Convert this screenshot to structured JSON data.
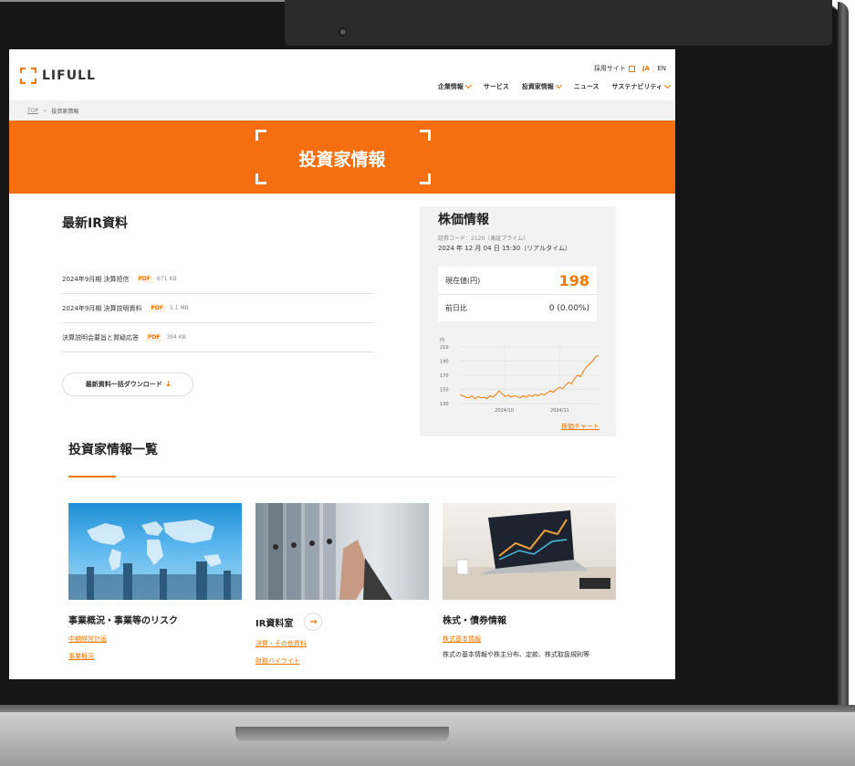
{
  "header": {
    "logo": "LIFULL",
    "top_links": {
      "recruit": "採用サイト",
      "lang_ja": "JA",
      "lang_en": "EN"
    },
    "nav": [
      "企業情報",
      "サービス",
      "投資家情報",
      "ニュース",
      "サステナビリティ"
    ]
  },
  "breadcrumb": {
    "home": "TOP",
    "current": "投資家情報"
  },
  "hero": {
    "title": "投資家情報"
  },
  "ir": {
    "title": "最新IR資料",
    "items": [
      {
        "label": "2024年9月期 決算短信",
        "type": "PDF",
        "size": "671 KB"
      },
      {
        "label": "2024年9月期 決算説明資料",
        "type": "PDF",
        "size": "5.1 MB"
      },
      {
        "label": "決算説明会要旨と質疑応答",
        "type": "PDF",
        "size": "394 KB"
      }
    ],
    "download_label": "最新資料一括ダウンロード"
  },
  "stock": {
    "title": "株価情報",
    "code": "証券コード：2120（東証プライム）",
    "time": "2024 年 12 月 04 日 15:30（リアルタイム）",
    "current_label": "現在値(円)",
    "current_value": "198",
    "change_label": "前日比",
    "change_value": "0 (0.00%)",
    "chart_link": "株価チャート"
  },
  "chart_data": {
    "type": "line",
    "ylabel": "円",
    "yticks": [
      "210",
      "190",
      "170",
      "150",
      "130"
    ],
    "ylim": [
      130,
      210
    ],
    "xticks": [
      "2024/10",
      "2024/11"
    ],
    "series": [
      {
        "values": [
          142,
          141,
          139,
          138,
          141,
          137,
          140,
          138,
          139,
          137,
          141,
          139,
          143,
          148,
          144,
          140,
          142,
          139,
          141,
          140,
          138,
          141,
          139,
          142,
          140,
          143,
          141,
          144,
          142,
          145,
          148,
          146,
          150,
          153,
          151,
          156,
          160,
          158,
          165,
          170,
          168,
          176,
          182,
          186,
          190,
          196,
          198
        ]
      }
    ]
  },
  "list": {
    "title": "投資家情報一覧",
    "cards": [
      {
        "title": "事業概況・事業等のリスク",
        "links": [
          "中期経営計画",
          "事業概況"
        ]
      },
      {
        "title": "IR資料室",
        "links": [
          "決算・その他資料",
          "財務ハイライト"
        ]
      },
      {
        "title": "株式・債券情報",
        "links": [
          "株式基本情報"
        ],
        "desc": "株式の基本情報や株主分布、定款、株式取扱規則等"
      }
    ]
  },
  "colors": {
    "accent": "#f07800",
    "hero": "#f56e0f"
  }
}
